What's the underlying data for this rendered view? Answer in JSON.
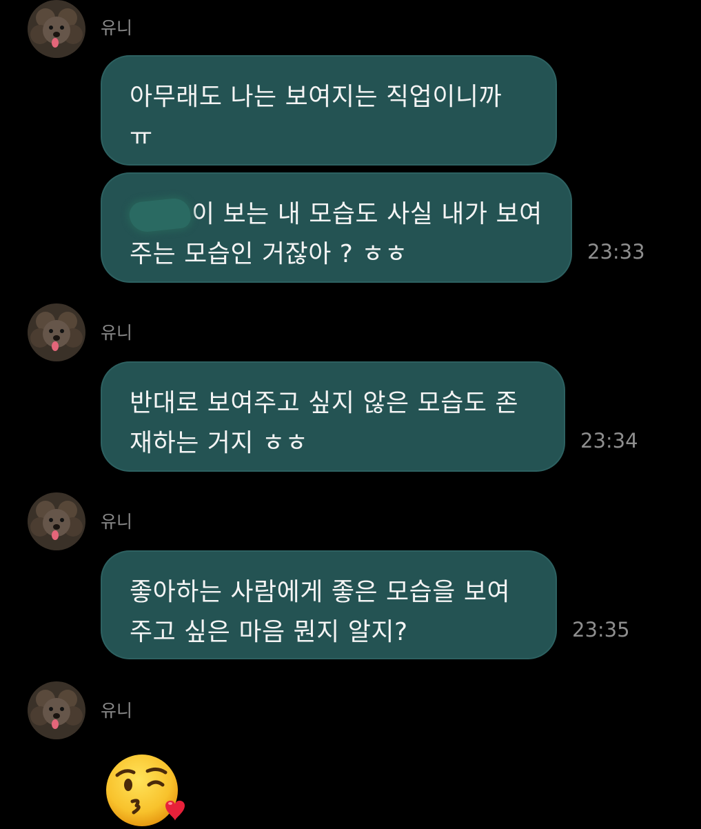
{
  "sender": {
    "name": "유니"
  },
  "messages": [
    {
      "lines": [
        "아무래도 나는 보여지는 직업이니까",
        "ㅠ"
      ],
      "time": ""
    },
    {
      "lines": [
        "이 보는 내 모습도 사실 내가 보여",
        "주는 모습인 거잖아 ? ㅎㅎ"
      ],
      "time": "23:33",
      "redacted_prefix": true
    },
    {
      "lines": [
        "반대로 보여주고 싶지 않은 모습도 존",
        "재하는 거지 ㅎㅎ"
      ],
      "time": "23:34"
    },
    {
      "lines": [
        "좋아하는 사람에게 좋은 모습을 보여",
        "주고 싶은 마음 뭔지 알지?"
      ],
      "time": "23:35"
    }
  ],
  "reaction": {
    "icon": "kissing-face-with-heart-emoji"
  },
  "colors": {
    "background": "#000000",
    "bubble": "#245353",
    "name": "#8b8b8b",
    "timestamp": "#8e8e8e"
  }
}
